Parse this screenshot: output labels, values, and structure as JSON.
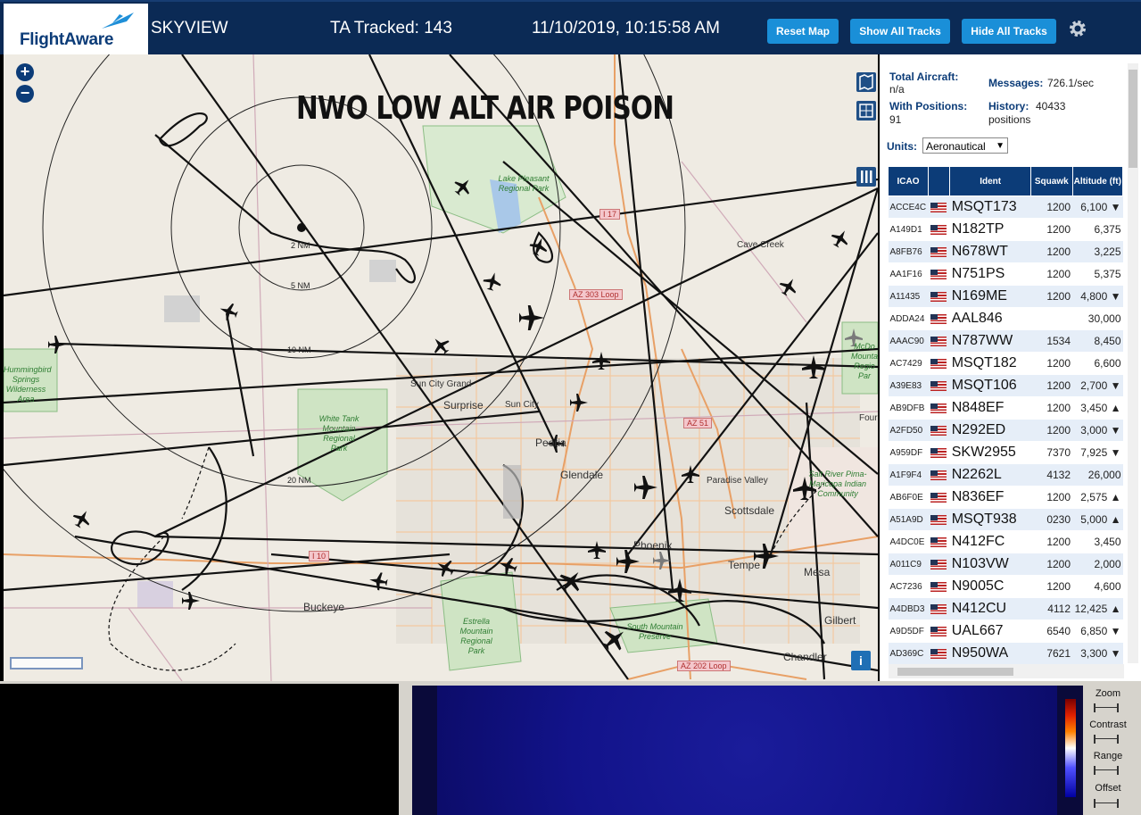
{
  "header": {
    "brand": "FlightAware",
    "app_name": "SKYVIEW",
    "tracked": "TA Tracked: 143",
    "datetime": "11/10/2019, 10:15:58 AM",
    "buttons": {
      "reset": "Reset Map",
      "show": "Show All Tracks",
      "hide": "Hide All Tracks"
    }
  },
  "map": {
    "overlay_title": "NWO LOW ALT AIR POISON",
    "zoom_in": "+",
    "zoom_out": "−",
    "range_rings": [
      "2 NM",
      "5 NM",
      "10 NM",
      "20 NM"
    ],
    "cities": [
      "Surprise",
      "Sun City",
      "Sun City Grand",
      "Peoria",
      "Glendale",
      "Phoenix",
      "Scottsdale",
      "Paradise Valley",
      "Tempe",
      "Mesa",
      "Gilbert",
      "Chandler",
      "Buckeye",
      "Cave Creek",
      "Four"
    ],
    "parks": [
      "Lake Pleasant Regional Park",
      "White Tank Mountain Regional Park",
      "Estrella Mountain Regional Park",
      "South Mountain Preserve",
      "Hummingbird Springs Wilderness Area",
      "Salt River Pima-Maricopa Indian Community",
      "McDo Mountain Regio Par"
    ],
    "highways": [
      "I 17",
      "AZ 303 Loop",
      "AZ 51",
      "I 10",
      "AZ 202 Loop"
    ],
    "info": "i"
  },
  "panel": {
    "total_aircraft_label": "Total Aircraft:",
    "total_aircraft_value": "n/a",
    "messages_label": "Messages:",
    "messages_value": "726.1/sec",
    "positions_label": "With Positions:",
    "positions_value": "91",
    "history_label": "History:",
    "history_value": "40433",
    "history_unit": "positions",
    "units_label": "Units:",
    "units_value": "Aeronautical",
    "columns": [
      "ICAO",
      "",
      "Ident",
      "Squawk",
      "Altitude (ft)"
    ],
    "rows": [
      {
        "icao": "ACCE4C",
        "ident": "MSQT173",
        "squawk": "1200",
        "alt": "6,100 ▼"
      },
      {
        "icao": "A149D1",
        "ident": "N182TP",
        "squawk": "1200",
        "alt": "6,375"
      },
      {
        "icao": "A8FB76",
        "ident": "N678WT",
        "squawk": "1200",
        "alt": "3,225"
      },
      {
        "icao": "AA1F16",
        "ident": "N751PS",
        "squawk": "1200",
        "alt": "5,375"
      },
      {
        "icao": "A11435",
        "ident": "N169ME",
        "squawk": "1200",
        "alt": "4,800 ▼"
      },
      {
        "icao": "ADDA24",
        "ident": "AAL846",
        "squawk": "",
        "alt": "30,000"
      },
      {
        "icao": "AAAC90",
        "ident": "N787WW",
        "squawk": "1534",
        "alt": "8,450"
      },
      {
        "icao": "AC7429",
        "ident": "MSQT182",
        "squawk": "1200",
        "alt": "6,600"
      },
      {
        "icao": "A39E83",
        "ident": "MSQT106",
        "squawk": "1200",
        "alt": "2,700 ▼"
      },
      {
        "icao": "AB9DFB",
        "ident": "N848EF",
        "squawk": "1200",
        "alt": "3,450 ▲"
      },
      {
        "icao": "A2FD50",
        "ident": "N292ED",
        "squawk": "1200",
        "alt": "3,000 ▼"
      },
      {
        "icao": "A959DF",
        "ident": "SKW2955",
        "squawk": "7370",
        "alt": "7,925 ▼"
      },
      {
        "icao": "A1F9F4",
        "ident": "N2262L",
        "squawk": "4132",
        "alt": "26,000"
      },
      {
        "icao": "AB6F0E",
        "ident": "N836EF",
        "squawk": "1200",
        "alt": "2,575 ▲"
      },
      {
        "icao": "A51A9D",
        "ident": "MSQT938",
        "squawk": "0230",
        "alt": "5,000 ▲"
      },
      {
        "icao": "A4DC0E",
        "ident": "N412FC",
        "squawk": "1200",
        "alt": "3,450"
      },
      {
        "icao": "A011C9",
        "ident": "N103VW",
        "squawk": "1200",
        "alt": "2,000"
      },
      {
        "icao": "AC7236",
        "ident": "N9005C",
        "squawk": "1200",
        "alt": "4,600"
      },
      {
        "icao": "A4DBD3",
        "ident": "N412CU",
        "squawk": "4112",
        "alt": "12,425 ▲"
      },
      {
        "icao": "A9D5DF",
        "ident": "UAL667",
        "squawk": "6540",
        "alt": "6,850 ▼"
      },
      {
        "icao": "AD369C",
        "ident": "N950WA",
        "squawk": "7621",
        "alt": "3,300 ▼"
      }
    ]
  },
  "spectrum": {
    "controls": [
      "Zoom",
      "Contrast",
      "Range",
      "Offset"
    ]
  },
  "colors": {
    "header_bg": "#0b2a55",
    "button": "#1a8fd8",
    "table_header": "#0c3c78"
  }
}
